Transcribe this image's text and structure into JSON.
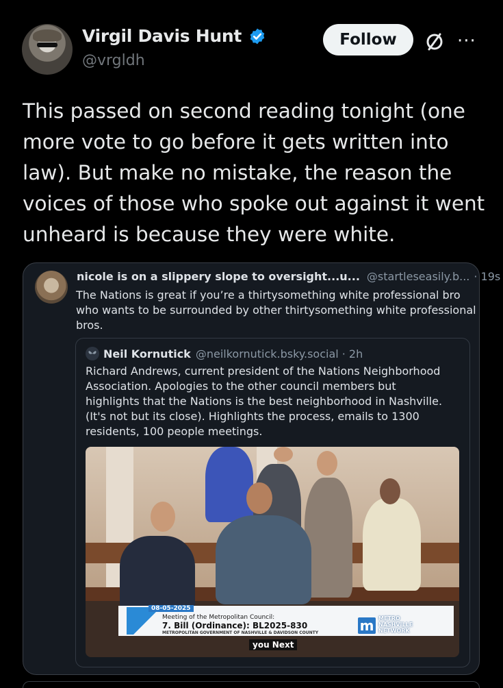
{
  "author": {
    "display_name": "Virgil Davis Hunt",
    "handle": "@vrgldh",
    "verified": true
  },
  "actions": {
    "follow_label": "Follow",
    "grok_icon": "grok-icon",
    "more_icon": "more-icon",
    "more_glyph": "···"
  },
  "tweet": {
    "text": "This passed on second reading tonight (one\nmore vote to go before it gets written into\nlaw). But make no mistake, the reason the\nvoices of those who spoke out against it went\nunheard is because they were white."
  },
  "quoted": {
    "name": "nicole is on a slippery slope to oversight...u...",
    "handle": "@startleseasily.b...",
    "time": "· 19s",
    "text": "The Nations is great if you’re a thirtysomething white professional bro who wants to be surrounded by other thirtysomething white professional bros.",
    "inner": {
      "name": "Neil Kornutick",
      "handle": "@neilkornutick.bsky.social",
      "time": "· 2h",
      "text": "Richard Andrews, current president of the Nations Neighborhood Association. Apologies to the other council members but highlights that the Nations is the best neighborhood in Nashville. (It's not but its close). Highlights the process, emails to 1300 residents, 100 people meetings.",
      "video": {
        "date": "08-05-2025",
        "line1": "Meeting of the Metropolitan Council:",
        "line2": "7. Bill (Ordinance): BL2025-830",
        "line3": "METROPOLITAN GOVERNMENT OF NASHVILLE & DAVIDSON COUNTY",
        "logo_letter": "m",
        "network": "METRO\nNASHVILLE\nNETWORK",
        "caption": "you Next"
      }
    }
  },
  "colors": {
    "background": "#000000",
    "verified_blue": "#1d9bf0",
    "muted": "#71767b",
    "card_bg": "#151a21"
  }
}
